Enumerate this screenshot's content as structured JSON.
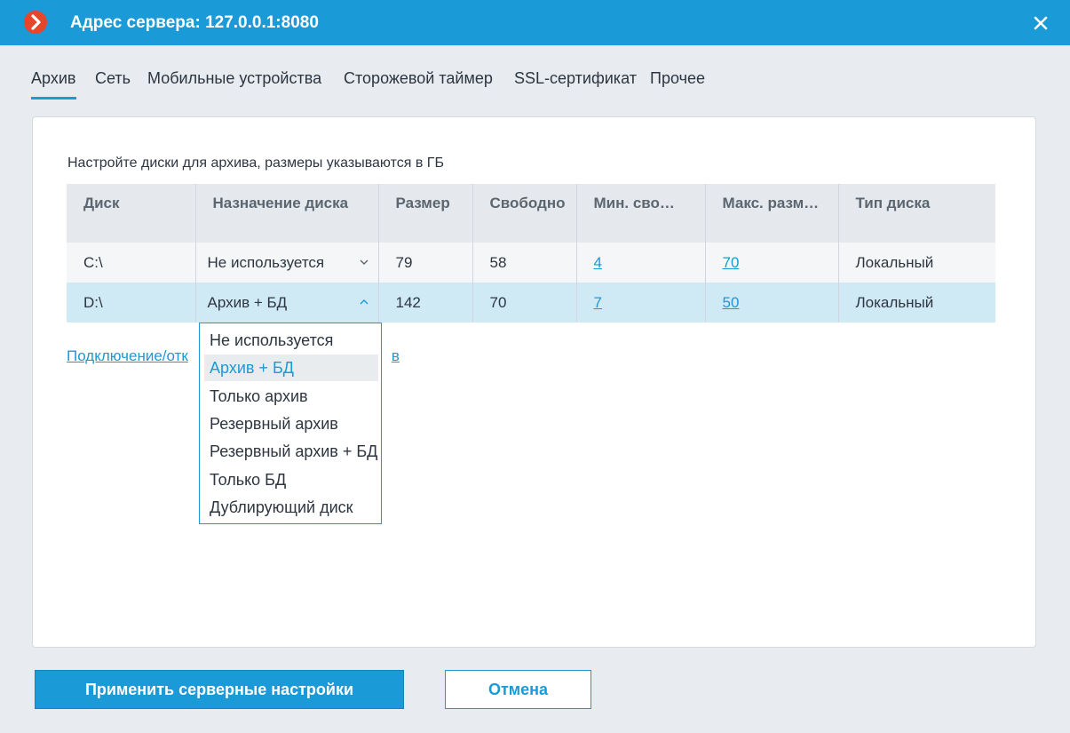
{
  "window": {
    "title": "Адрес сервера: 127.0.0.1:8080",
    "accent_color": "#1a9ad6",
    "logo_color": "#e8462b",
    "logo_icon": "chevron-right-icon",
    "close_icon": "close-icon"
  },
  "tabs": [
    {
      "label": "Архив",
      "active": true
    },
    {
      "label": "Сеть",
      "active": false
    },
    {
      "label": "Мобильные устройства",
      "active": false
    },
    {
      "label": "Сторожевой таймер",
      "active": false
    },
    {
      "label": "SSL-сертификат",
      "active": false
    },
    {
      "label": "Прочее",
      "active": false
    }
  ],
  "archive": {
    "hint": "Настройте диски для архива, размеры указываются в ГБ",
    "columns": [
      "Диск",
      "Назначение диска",
      "Размер",
      "Свободно",
      "Мин. сво…",
      "Макс. разм…",
      "Тип диска"
    ],
    "rows": [
      {
        "disk": "C:\\",
        "purpose": "Не используется",
        "size": "79",
        "free": "58",
        "min_free": "4",
        "max_size": "70",
        "type": "Локальный",
        "expanded": false
      },
      {
        "disk": "D:\\",
        "purpose": "Архив + БД",
        "size": "142",
        "free": "70",
        "min_free": "7",
        "max_size": "50",
        "type": "Локальный",
        "expanded": true
      }
    ],
    "manage_link_visible_start": "Подключение/отк",
    "manage_link_visible_end": "в",
    "dropdown_options": [
      "Не используется",
      "Архив + БД",
      "Только архив",
      "Резервный архив",
      "Резервный архив + БД",
      "Только БД",
      "Дублирующий диск"
    ],
    "dropdown_selected": "Архив + БД"
  },
  "buttons": {
    "apply": "Применить серверные настройки",
    "cancel": "Отмена"
  }
}
